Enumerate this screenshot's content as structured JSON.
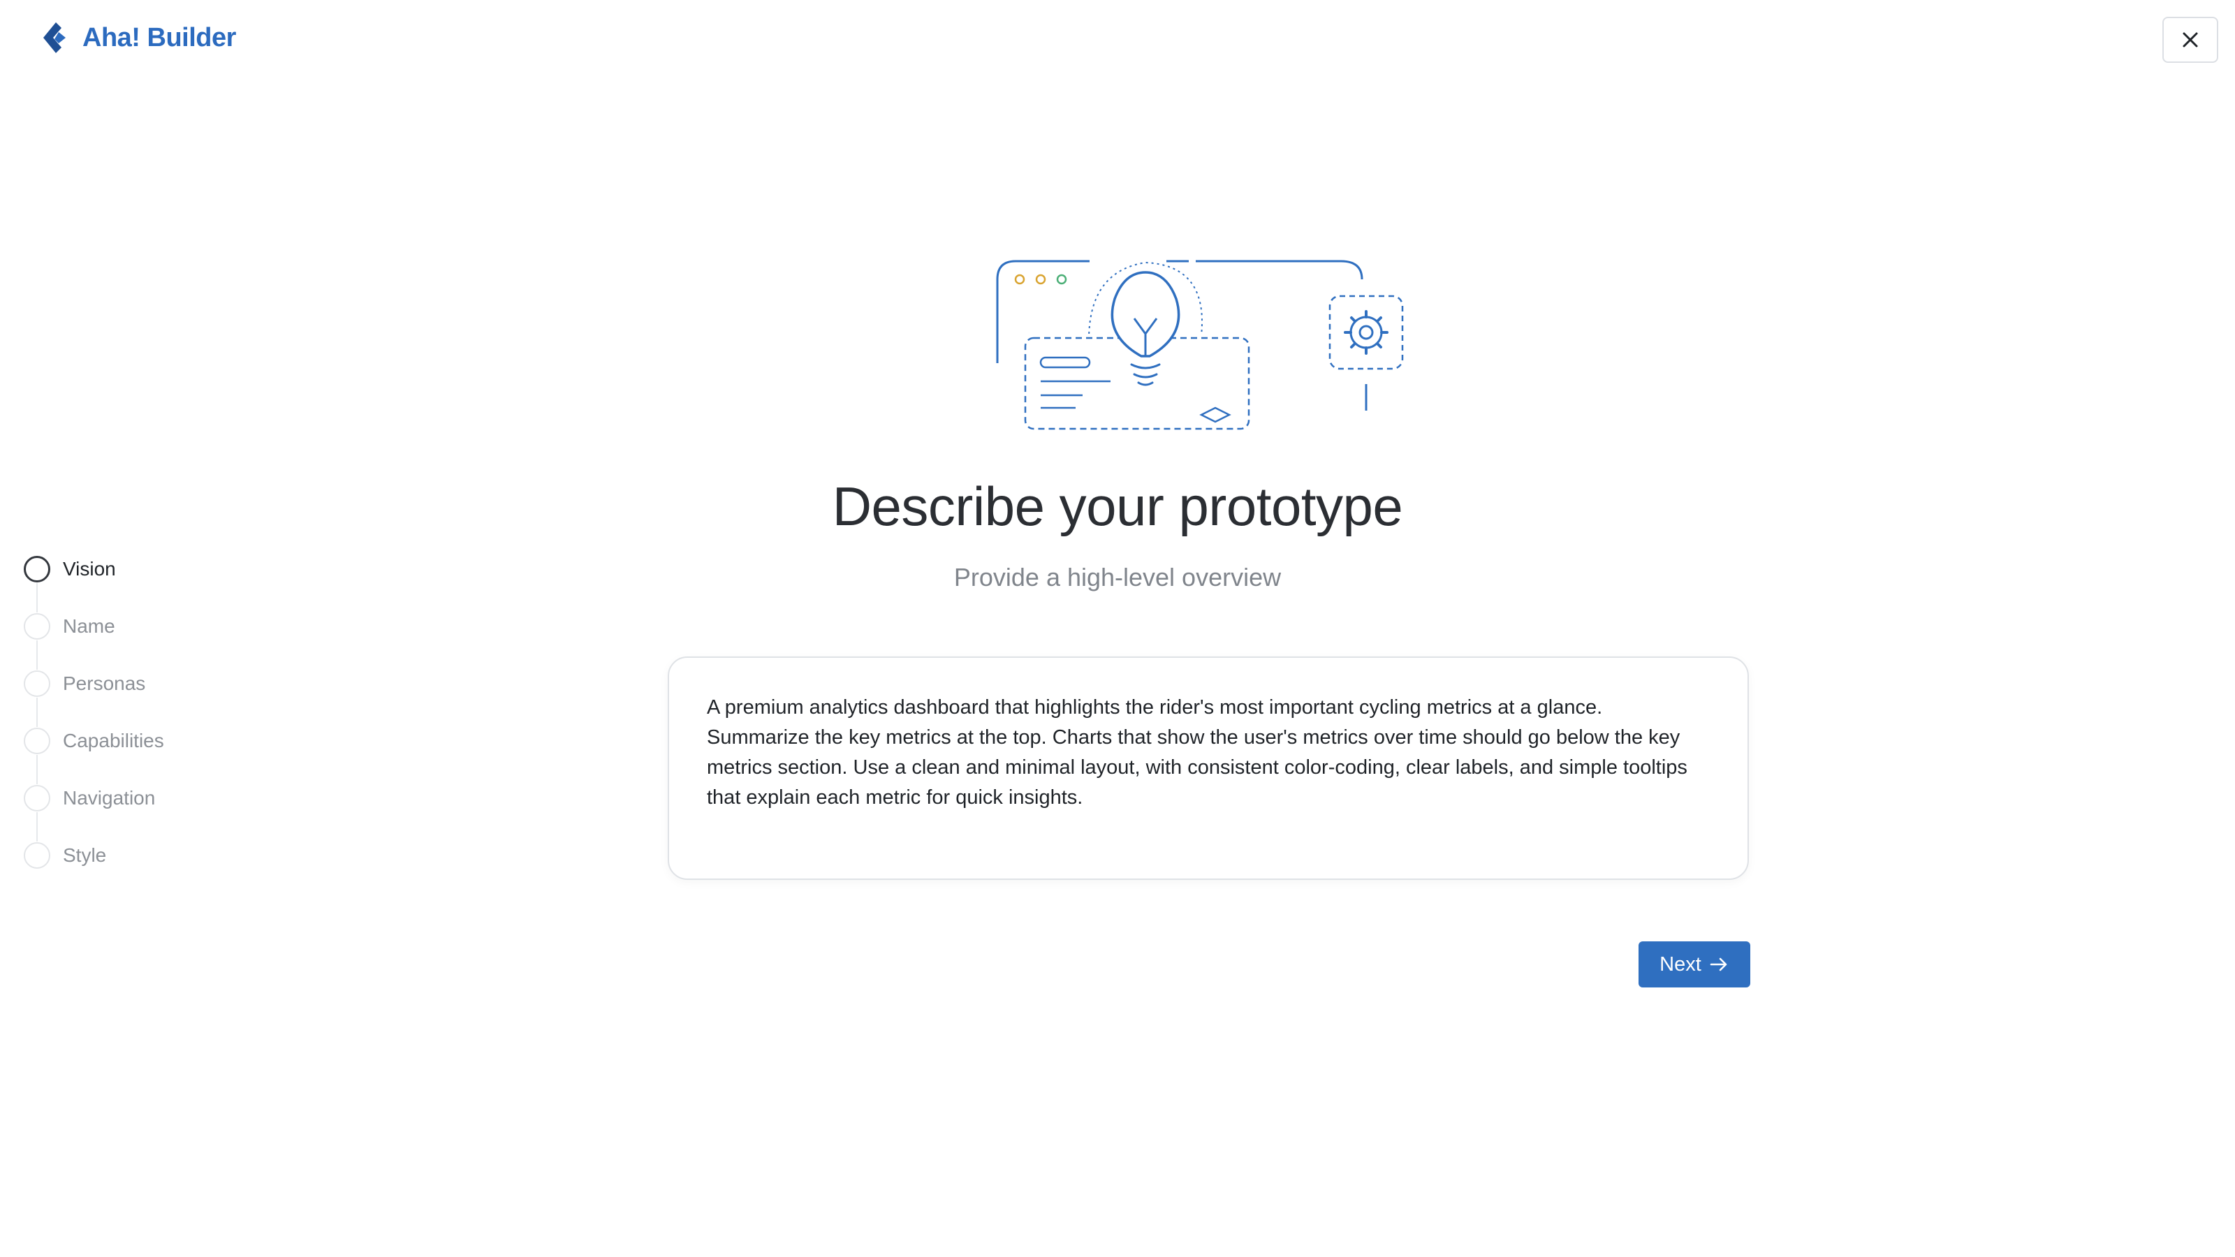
{
  "app": {
    "brand_name": "Aha! Builder",
    "brand_color": "#2c6bbf",
    "accent_color": "#2f6fc0"
  },
  "header": {
    "close_icon": "close-icon"
  },
  "stepper": {
    "active_index": 0,
    "steps": [
      {
        "label": "Vision"
      },
      {
        "label": "Name"
      },
      {
        "label": "Personas"
      },
      {
        "label": "Capabilities"
      },
      {
        "label": "Navigation"
      },
      {
        "label": "Style"
      }
    ]
  },
  "main": {
    "illustration_icon": "lightbulb-prototype-illustration",
    "title": "Describe your prototype",
    "subtitle": "Provide a high-level overview",
    "description_value": "A premium analytics dashboard that highlights the rider's most important cycling metrics at a glance. Summarize the key metrics at the top. Charts that show the user's metrics over time should go below the key metrics section. Use a clean and minimal layout, with consistent color-coding, clear labels, and simple tooltips that explain each metric for quick insights.",
    "next_label": "Next",
    "next_icon": "arrow-right-icon"
  }
}
